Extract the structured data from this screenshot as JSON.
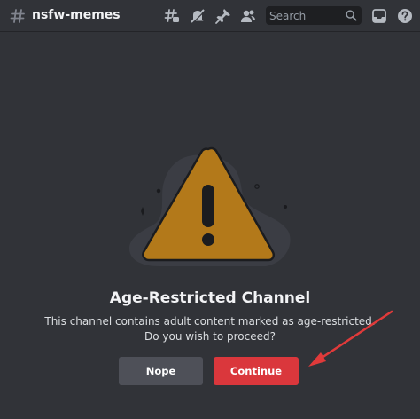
{
  "header": {
    "channel_name": "nsfw-memes",
    "search_placeholder": "Search",
    "icons": [
      "threads-icon",
      "mute-icon",
      "pin-icon",
      "members-icon",
      "search-icon",
      "inbox-icon",
      "help-icon"
    ]
  },
  "main": {
    "title": "Age-Restricted Channel",
    "description_line1": "This channel contains adult content marked as age-restricted.",
    "description_line2": "Do you wish to proceed?",
    "nope_label": "Nope",
    "continue_label": "Continue"
  },
  "colors": {
    "background": "#313338",
    "warning_fill": "#b3791a",
    "continue_button": "#da373c",
    "nope_button": "#4e5058",
    "annotation_arrow": "#e03a3a"
  }
}
